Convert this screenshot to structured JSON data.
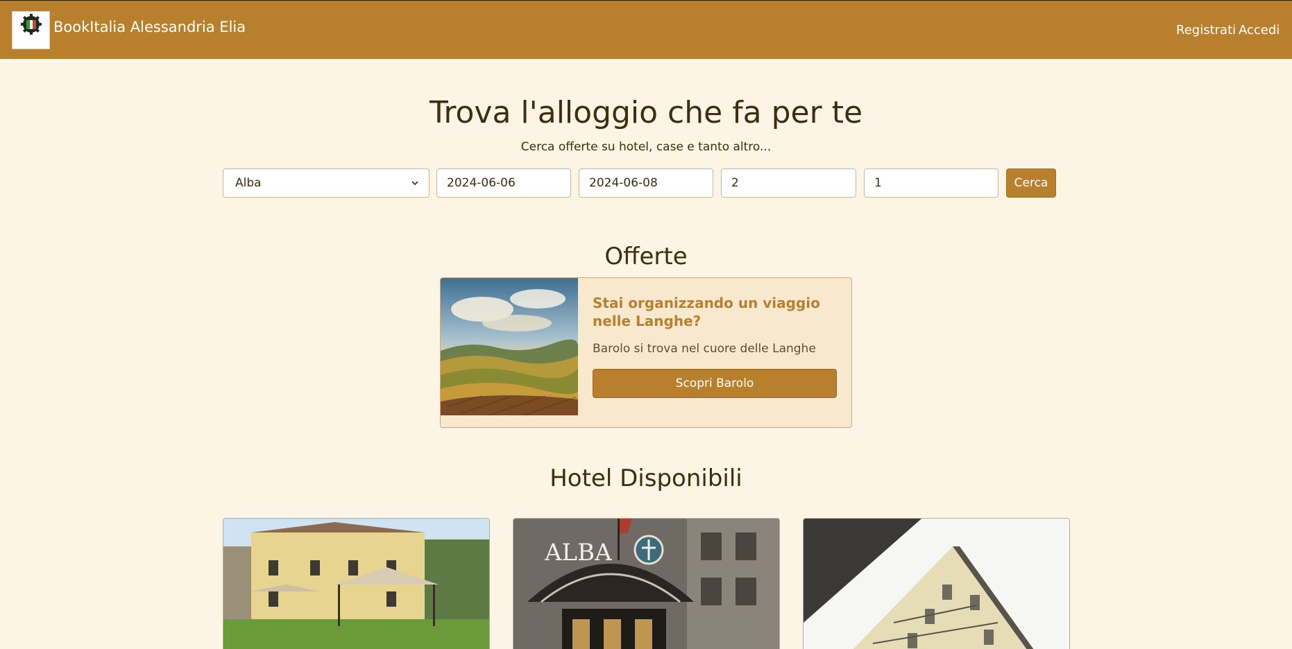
{
  "navbar": {
    "brand_name": "BookItalia Alessandria Elia",
    "logo_text": "BookItalia",
    "links": {
      "register": "Registrati",
      "login": "Accedi"
    },
    "background": "#b8802d"
  },
  "hero": {
    "title": "Trova l'alloggio che fa per te",
    "subtitle": "Cerca offerte su hotel, case e tanto altro..."
  },
  "search": {
    "city_selected": "Alba",
    "checkin": "2024-06-06",
    "checkout": "2024-06-08",
    "adults": "2",
    "rooms": "1",
    "button_label": "Cerca"
  },
  "offers": {
    "section_title": "Offerte",
    "card": {
      "title": "Stai organizzando un viaggio nelle Langhe?",
      "text": "Barolo si trova nel cuore delle Langhe",
      "button_label": "Scopri Barolo",
      "image": "langhe-vineyard-landscape"
    }
  },
  "hotels": {
    "section_title": "Hotel Disponibili",
    "items": [
      {
        "image": "yellow-villa-with-gazebo"
      },
      {
        "image": "hotel-alba-entrance-canopy"
      },
      {
        "image": "cream-building-corner"
      }
    ]
  },
  "colors": {
    "accent": "#b8802d",
    "page_bg": "#fcf5e6",
    "text": "#3d2e0e"
  }
}
